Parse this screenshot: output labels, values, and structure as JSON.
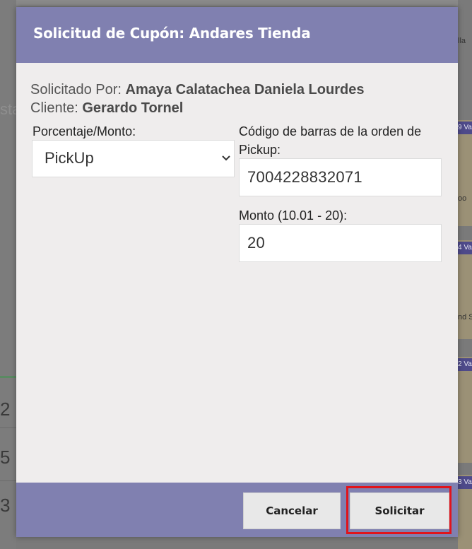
{
  "modal": {
    "title": "Solicitud de Cupón: Andares Tienda",
    "requested_by_label": "Solicitado Por:",
    "requested_by_value": "Amaya Calatachea Daniela Lourdes",
    "client_label": "Cliente:",
    "client_value": "Gerardo Tornel"
  },
  "form": {
    "type_label": "Porcentaje/Monto:",
    "type_selected": "PickUp",
    "barcode_label_line1": "Código de barras de la orden de",
    "barcode_label_line2": "Pickup:",
    "barcode_value": "7004228832071",
    "amount_label": "Monto (10.01 - 20):",
    "amount_value": "20"
  },
  "footer": {
    "cancel_label": "Cancelar",
    "submit_label": "Solicitar"
  },
  "background": {
    "left_numbers": [
      "2",
      "5",
      "3"
    ],
    "right_fragments": [
      "lla",
      "9 Va",
      "oo",
      "4 Va",
      "nd S",
      "2 Va",
      "3 Va"
    ]
  },
  "colors": {
    "header": "#8080b0",
    "highlight": "#e0141c"
  }
}
